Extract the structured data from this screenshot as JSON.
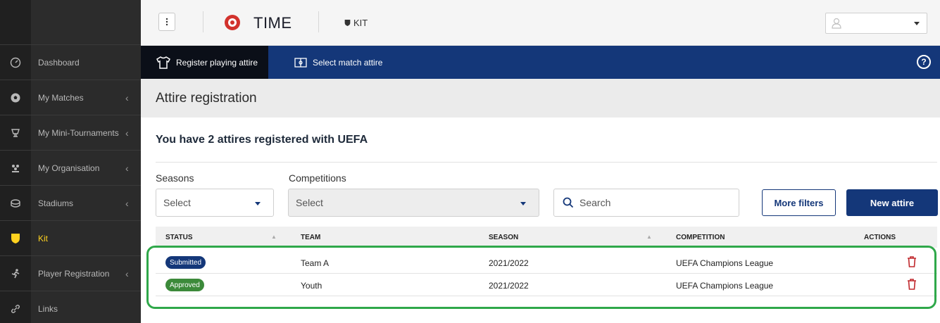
{
  "app": {
    "brand": "TIME",
    "module": "KIT"
  },
  "colors": {
    "nav_blue": "#143779",
    "sidebar_bg": "#2b2b2b",
    "active_yellow": "#ffd21f",
    "highlight_green": "#2fa84a",
    "submitted": "#143779",
    "approved": "#3c8a3a",
    "trash_red": "#c0282d"
  },
  "sidebar": {
    "items": [
      {
        "label": "Dashboard",
        "icon": "gauge-icon"
      },
      {
        "label": "My Matches",
        "icon": "football-icon"
      },
      {
        "label": "My Mini-Tournaments",
        "icon": "trophy-icon"
      },
      {
        "label": "My Organisation",
        "icon": "people-icon"
      },
      {
        "label": "Stadiums",
        "icon": "stadium-icon"
      },
      {
        "label": "Kit",
        "icon": "shield-icon",
        "active": true
      },
      {
        "label": "Player Registration",
        "icon": "runner-icon"
      },
      {
        "label": "Links",
        "icon": "link-icon"
      }
    ]
  },
  "nav": {
    "tabs": [
      {
        "label": "Register playing attire",
        "icon": "shirt-icon",
        "active": true
      },
      {
        "label": "Select match attire",
        "icon": "pitch-icon"
      }
    ]
  },
  "page": {
    "title": "Attire registration",
    "subtitle": "You have 2 attires registered with UEFA"
  },
  "filters": {
    "seasons_label": "Seasons",
    "seasons_value": "Select",
    "competitions_label": "Competitions",
    "competitions_value": "Select",
    "search_placeholder": "Search",
    "more_filters": "More filters",
    "new_attire": "New attire"
  },
  "table": {
    "headers": [
      "STATUS",
      "TEAM",
      "SEASON",
      "COMPETITION",
      "ACTIONS"
    ],
    "rows": [
      {
        "status": "Submitted",
        "team": "Team A",
        "season": "2021/2022",
        "competition": "UEFA Champions League"
      },
      {
        "status": "Approved",
        "team": "Youth",
        "season": "2021/2022",
        "competition": "UEFA Champions League"
      }
    ]
  }
}
